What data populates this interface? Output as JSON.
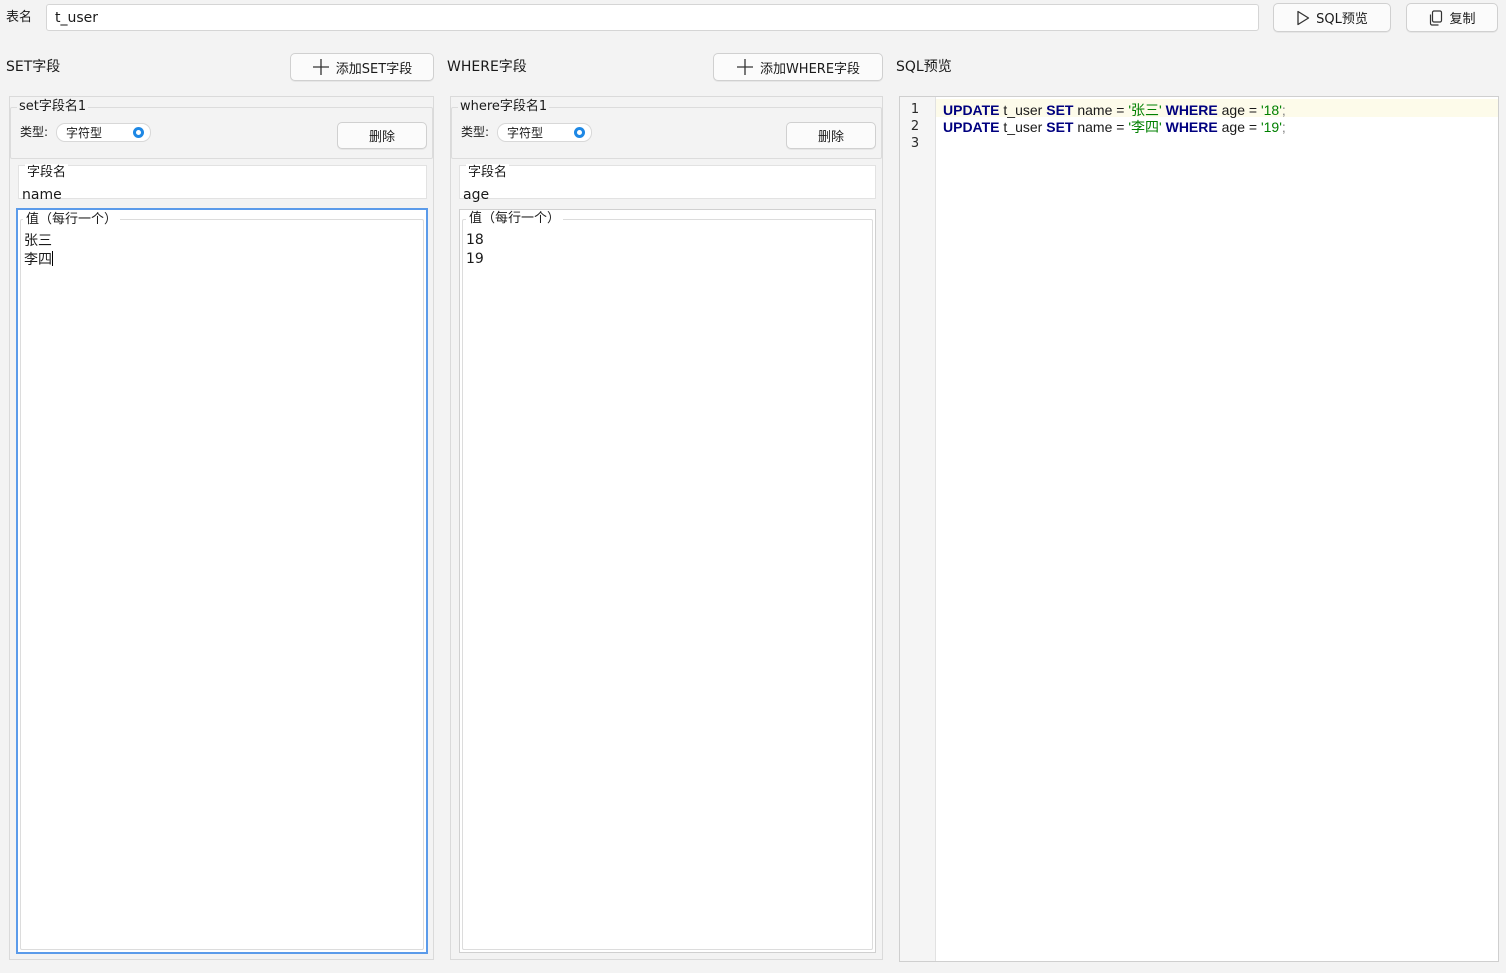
{
  "top": {
    "table_label": "表名",
    "table_value": "t_user",
    "preview_button": "SQL预览",
    "copy_button": "复制"
  },
  "set_section": {
    "title": "SET字段",
    "add_button": "添加SET字段",
    "group_title": "set字段名1",
    "type_label": "类型:",
    "type_value": "字符型",
    "delete_button": "删除",
    "field_title": "字段名",
    "field_value": "name",
    "values_title": "值（每行一个）",
    "values": [
      "张三",
      "李四"
    ]
  },
  "where_section": {
    "title": "WHERE字段",
    "add_button": "添加WHERE字段",
    "group_title": "where字段名1",
    "type_label": "类型:",
    "type_value": "字符型",
    "delete_button": "删除",
    "field_title": "字段名",
    "field_value": "age",
    "values_title": "值（每行一个）",
    "values": [
      "18",
      "19"
    ]
  },
  "sql_section": {
    "title": "SQL预览",
    "line_numbers": [
      "1",
      "2",
      "3"
    ],
    "lines": [
      [
        {
          "t": "UPDATE",
          "c": "kw"
        },
        {
          "t": " t_user ",
          "c": "id"
        },
        {
          "t": "SET",
          "c": "kw"
        },
        {
          "t": " name ",
          "c": "id"
        },
        {
          "t": "=",
          "c": "op"
        },
        {
          "t": " ",
          "c": "id"
        },
        {
          "t": "'张三'",
          "c": "str"
        },
        {
          "t": " ",
          "c": "id"
        },
        {
          "t": "WHERE",
          "c": "kw"
        },
        {
          "t": " age ",
          "c": "id"
        },
        {
          "t": "=",
          "c": "op"
        },
        {
          "t": " ",
          "c": "id"
        },
        {
          "t": "'18'",
          "c": "str"
        },
        {
          "t": ";",
          "c": "semi"
        }
      ],
      [
        {
          "t": "UPDATE",
          "c": "kw"
        },
        {
          "t": " t_user ",
          "c": "id"
        },
        {
          "t": "SET",
          "c": "kw"
        },
        {
          "t": " name ",
          "c": "id"
        },
        {
          "t": "=",
          "c": "op"
        },
        {
          "t": " ",
          "c": "id"
        },
        {
          "t": "'李四'",
          "c": "str"
        },
        {
          "t": " ",
          "c": "id"
        },
        {
          "t": "WHERE",
          "c": "kw"
        },
        {
          "t": " age ",
          "c": "id"
        },
        {
          "t": "=",
          "c": "op"
        },
        {
          "t": " ",
          "c": "id"
        },
        {
          "t": "'19'",
          "c": "str"
        },
        {
          "t": ";",
          "c": "semi"
        }
      ],
      []
    ]
  },
  "colors": {
    "keyword": "#00007f",
    "string": "#008000",
    "focus_border": "#5b9bea",
    "combo_indicator": "#1e88e5"
  },
  "icons": {
    "preview": "play-triangle-icon",
    "copy": "copy-icon",
    "add": "plus-icon",
    "combo": "radio-dot-icon"
  }
}
